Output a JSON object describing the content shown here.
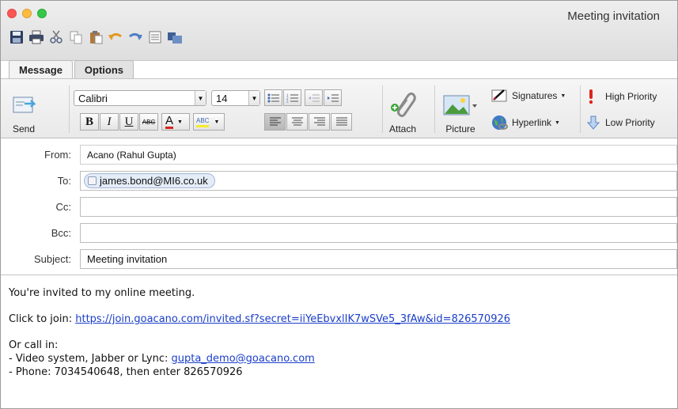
{
  "window": {
    "title": "Meeting invitation"
  },
  "quick_toolbar": [
    "save-icon",
    "print-icon",
    "cut-icon",
    "copy-icon",
    "paste-icon",
    "undo-icon",
    "redo-icon",
    "format-icon",
    "folder-icon"
  ],
  "tabs": [
    {
      "label": "Message",
      "active": true
    },
    {
      "label": "Options",
      "active": false
    }
  ],
  "ribbon": {
    "send_label": "Send",
    "font_name": "Calibri",
    "font_size": "14",
    "bold": "B",
    "italic": "I",
    "underline": "U",
    "strike": "ABC",
    "font_color": "A",
    "highlight": "ABC",
    "attach_label": "Attach",
    "picture_label": "Picture",
    "signatures_label": "Signatures",
    "hyperlink_label": "Hyperlink",
    "high_priority_label": "High Priority",
    "low_priority_label": "Low Priority"
  },
  "headers": {
    "from_label": "From:",
    "from_value": "Acano (Rahul Gupta)",
    "to_label": "To:",
    "to_value": "james.bond@MI6.co.uk",
    "cc_label": "Cc:",
    "bcc_label": "Bcc:",
    "subject_label": "Subject:",
    "subject_value": "Meeting invitation"
  },
  "body": {
    "intro": "You're invited to my online meeting.",
    "join_prefix": "Click to join: ",
    "join_url": "https://join.goacano.com/invited.sf?secret=iiYeEbvxlIK7wSVe5_3fAw&id=826570926",
    "call_in": "Or call in:",
    "video_prefix": "- Video system, Jabber or Lync: ",
    "video_address": "gupta_demo@goacano.com",
    "phone_line": "- Phone: 7034540648, then enter 826570926"
  },
  "colors": {
    "accent": "#1a3ec9",
    "priority_high": "#e0241b"
  }
}
